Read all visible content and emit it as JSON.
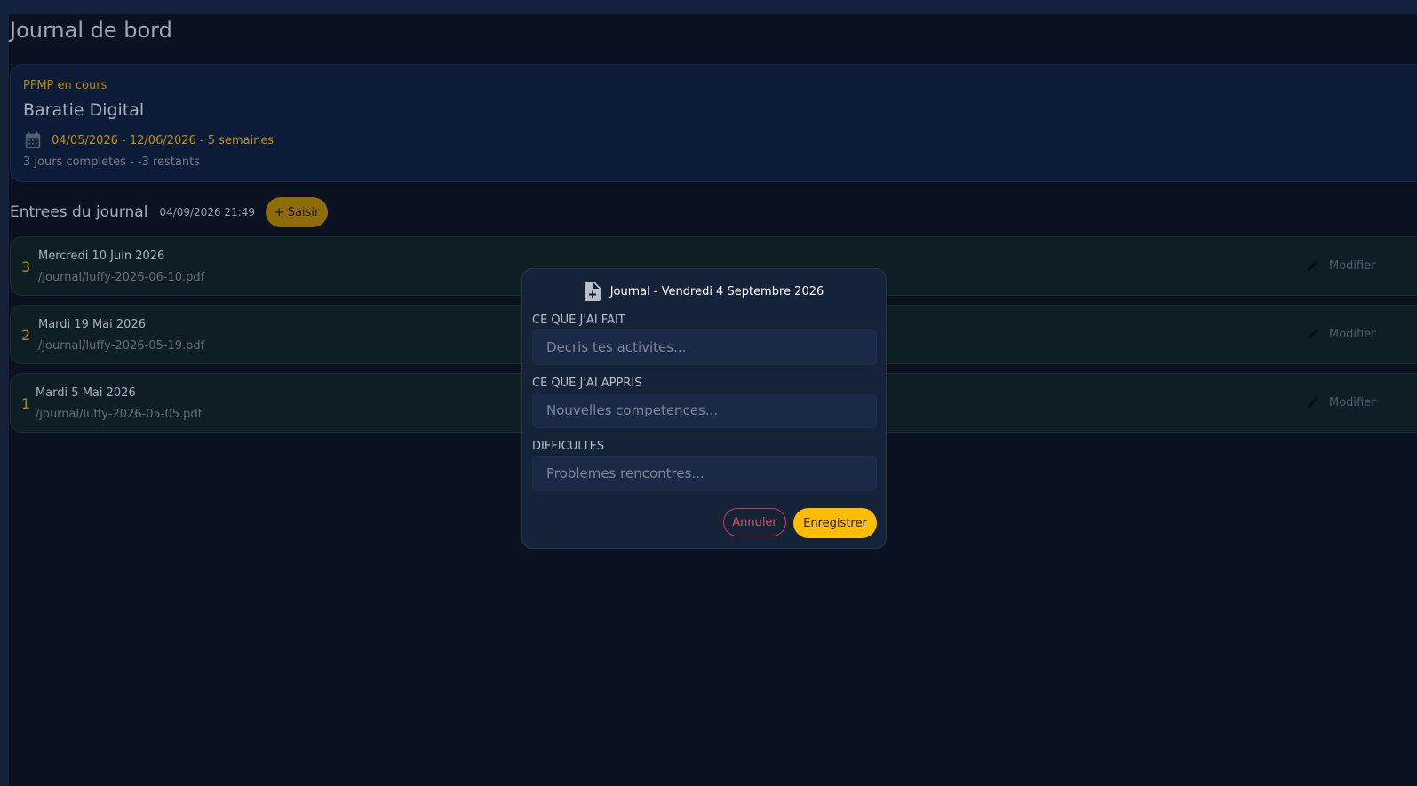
{
  "page": {
    "title": "Journal de bord"
  },
  "pfmp": {
    "status": "PFMP en cours",
    "company": "Baratie Digital",
    "dates": "04/05/2026 - 12/06/2026 - 5 semaines",
    "progress": "3 jours completes - -3 restants",
    "calendar_icon": "calendar-icon"
  },
  "entries": {
    "title": "Entrees du journal",
    "timestamp": "04/09/2026 21:49",
    "add_button": "+ Saisir",
    "edit_icon": "pencil-icon",
    "items": [
      {
        "number": "3",
        "date": "Mercredi 10 Juin 2026",
        "path": "/journal/luffy-2026-06-10.pdf",
        "edit_label": "Modifier"
      },
      {
        "number": "2",
        "date": "Mardi 19 Mai 2026",
        "path": "/journal/luffy-2026-05-19.pdf",
        "edit_label": "Modifier"
      },
      {
        "number": "1",
        "date": "Mardi 5 Mai 2026",
        "path": "/journal/luffy-2026-05-05.pdf",
        "edit_label": "Modifier"
      }
    ]
  },
  "modal": {
    "icon": "file-plus-icon",
    "title": "Journal - Vendredi 4 Septembre 2026",
    "fields": [
      {
        "label": "CE QUE J'AI FAIT",
        "value": "",
        "placeholder": "Decris tes activites..."
      },
      {
        "label": "CE QUE J'AI APPRIS",
        "value": "",
        "placeholder": "Nouvelles competences..."
      },
      {
        "label": "DIFFICULTES",
        "value": "",
        "placeholder": "Problemes rencontres..."
      }
    ],
    "cancel_label": "Annuler",
    "save_label": "Enregistrer"
  },
  "colors": {
    "background": "#0b1425",
    "accent": "#ffbd00",
    "accent_muted": "#c79410",
    "danger": "#e0535b"
  }
}
